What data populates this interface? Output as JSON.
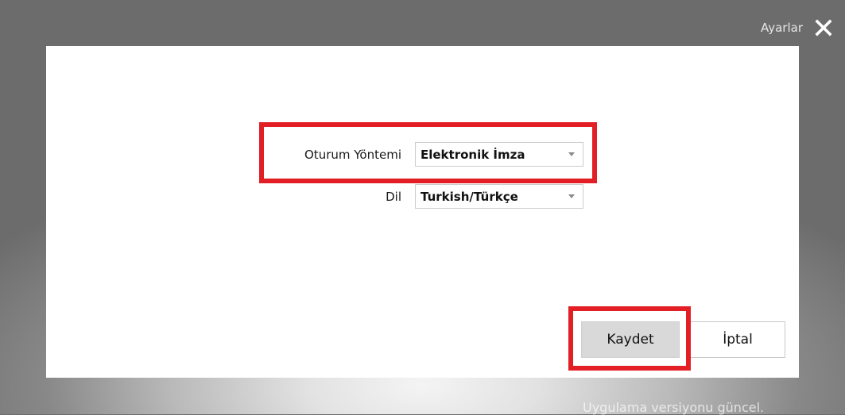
{
  "window": {
    "title": "Ayarlar",
    "close_icon": "close-icon"
  },
  "settings": {
    "login_method": {
      "label": "Oturum Yöntemi",
      "value": "Elektronik İmza"
    },
    "language": {
      "label": "Dil",
      "value": "Turkish/Türkçe"
    }
  },
  "buttons": {
    "save_label": "Kaydet",
    "cancel_label": "İptal"
  },
  "footer": {
    "version_status": "Uygulama versiyonu güncel."
  },
  "colors": {
    "highlight": "#e31f26",
    "dialog_background": "#ffffff",
    "save_button_background": "#d9d9d9"
  }
}
